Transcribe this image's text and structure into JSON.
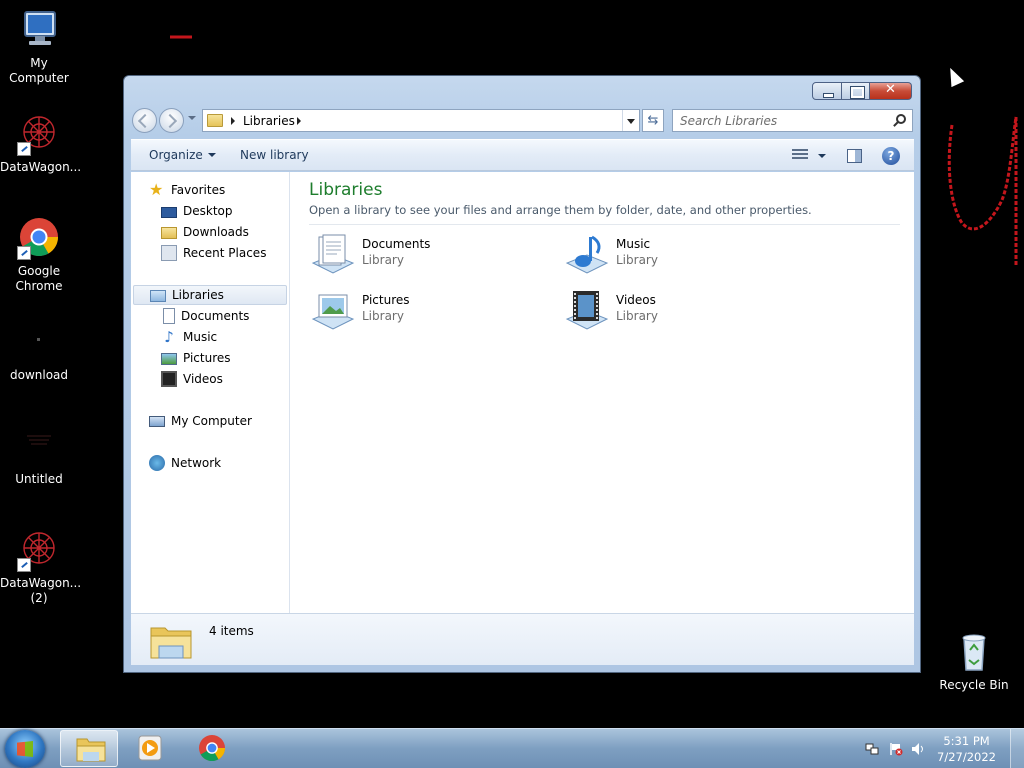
{
  "desktop": {
    "icons": [
      {
        "label": "My Computer"
      },
      {
        "label": "DataWagon..."
      },
      {
        "label": "Google Chrome"
      },
      {
        "label": "download"
      },
      {
        "label": "Untitled"
      },
      {
        "label": "DataWagon... (2)"
      },
      {
        "label": "Recycle Bin"
      }
    ]
  },
  "window": {
    "address": {
      "crumb": "Libraries"
    },
    "search": {
      "placeholder": "Search Libraries"
    },
    "toolbar": {
      "organize": "Organize",
      "new_library": "New library"
    },
    "nav": {
      "favorites": "Favorites",
      "desktop": "Desktop",
      "downloads": "Downloads",
      "recent_places": "Recent Places",
      "libraries": "Libraries",
      "documents": "Documents",
      "music": "Music",
      "pictures": "Pictures",
      "videos": "Videos",
      "my_computer": "My Computer",
      "network": "Network"
    },
    "main": {
      "title": "Libraries",
      "subtitle": "Open a library to see your files and arrange them by folder, date, and other properties.",
      "libraries": [
        {
          "name": "Documents",
          "type": "Library"
        },
        {
          "name": "Music",
          "type": "Library"
        },
        {
          "name": "Pictures",
          "type": "Library"
        },
        {
          "name": "Videos",
          "type": "Library"
        }
      ]
    },
    "details": {
      "count": "4 items"
    }
  },
  "taskbar": {
    "clock": {
      "time": "5:31 PM",
      "date": "7/27/2022"
    }
  },
  "colors": {
    "title_green": "#1e7d2d",
    "taskbar": "#7e9fc1",
    "desktop_bg": "#000000"
  }
}
